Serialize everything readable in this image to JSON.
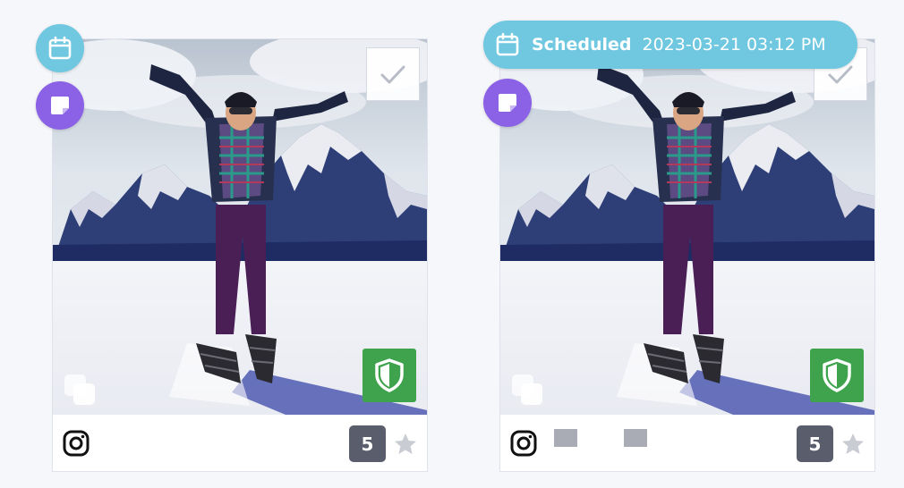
{
  "cards": [
    {
      "id": "card-1",
      "score": "5",
      "starred": false,
      "platform": "instagram-icon",
      "approved_badge": "shield-icon",
      "selected": false
    },
    {
      "id": "card-2",
      "score": "5",
      "starred": false,
      "platform": "instagram-icon",
      "approved_badge": "shield-icon",
      "selected": false
    }
  ],
  "scheduled": {
    "status_label": "Scheduled",
    "datetime": "2023-03-21 03:12 PM"
  },
  "icons": {
    "schedule": "calendar-icon",
    "note": "note-icon",
    "select": "checkmark-icon",
    "multi": "multi-media-icon",
    "favorite": "star-icon"
  },
  "colors": {
    "calendar_button": "#6fc7e0",
    "note_button": "#8b62e6",
    "approved_badge": "#3fa34d",
    "score_badge": "#5a5e6c",
    "star_inactive": "#c9ccd3"
  }
}
